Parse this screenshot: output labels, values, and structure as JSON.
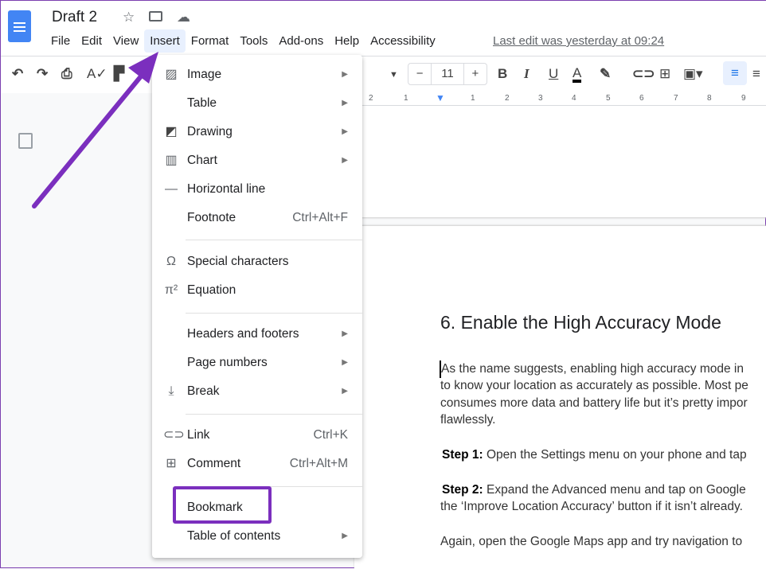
{
  "app": {
    "title": "Draft 2",
    "menu": [
      "File",
      "Edit",
      "View",
      "Insert",
      "Format",
      "Tools",
      "Add-ons",
      "Help",
      "Accessibility"
    ],
    "active_menu": "Insert",
    "last_edit": "Last edit was yesterday at 09:24"
  },
  "toolbar": {
    "font_size": "11",
    "minus": "−",
    "plus": "+",
    "bold": "B",
    "italic": "I",
    "underline": "U",
    "text_color": "A"
  },
  "ruler": [
    "2",
    "1",
    "1",
    "2",
    "3",
    "4",
    "5",
    "6",
    "7",
    "8",
    "9"
  ],
  "insert_menu": [
    {
      "icon": "image-icon",
      "label": "Image",
      "submenu": true
    },
    {
      "icon": "",
      "label": "Table",
      "submenu": true
    },
    {
      "icon": "drawing-icon",
      "label": "Drawing",
      "submenu": true
    },
    {
      "icon": "chart-icon",
      "label": "Chart",
      "submenu": true
    },
    {
      "icon": "horizontal-line-icon",
      "label": "Horizontal line"
    },
    {
      "icon": "",
      "label": "Footnote",
      "shortcut": "Ctrl+Alt+F"
    },
    {
      "icon": "omega-icon",
      "label": "Special characters"
    },
    {
      "icon": "pi-icon",
      "label": "Equation"
    },
    {
      "icon": "",
      "label": "Headers and footers",
      "submenu": true
    },
    {
      "icon": "",
      "label": "Page numbers",
      "submenu": true
    },
    {
      "icon": "break-icon",
      "label": "Break",
      "submenu": true
    },
    {
      "icon": "link-icon",
      "label": "Link",
      "shortcut": "Ctrl+K"
    },
    {
      "icon": "comment-icon",
      "label": "Comment",
      "shortcut": "Ctrl+Alt+M"
    },
    {
      "icon": "",
      "label": "Bookmark",
      "highlighted": true
    },
    {
      "icon": "",
      "label": "Table of contents",
      "submenu": true
    }
  ],
  "document": {
    "heading": "6. Enable the High Accuracy Mode",
    "para1": [
      "As the name suggests, enabling high accuracy mode in",
      "to know your location as accurately as possible. Most pe",
      "consumes more data and battery life but it’s pretty impor",
      "flawlessly."
    ],
    "step1_label": "Step 1:",
    "step1": " Open the Settings menu on your phone and tap",
    "step2_label": "Step 2:",
    "step2": " Expand the Advanced menu and tap on Google",
    "step2_line2": "the ‘Improve Location Accuracy’ button if it isn’t already.",
    "para_last": "Again, open the Google Maps app and try navigation to"
  },
  "colors": {
    "annotation": "#7b2fbe",
    "accent": "#4285f4",
    "menu_active": "#e8f0fe"
  }
}
